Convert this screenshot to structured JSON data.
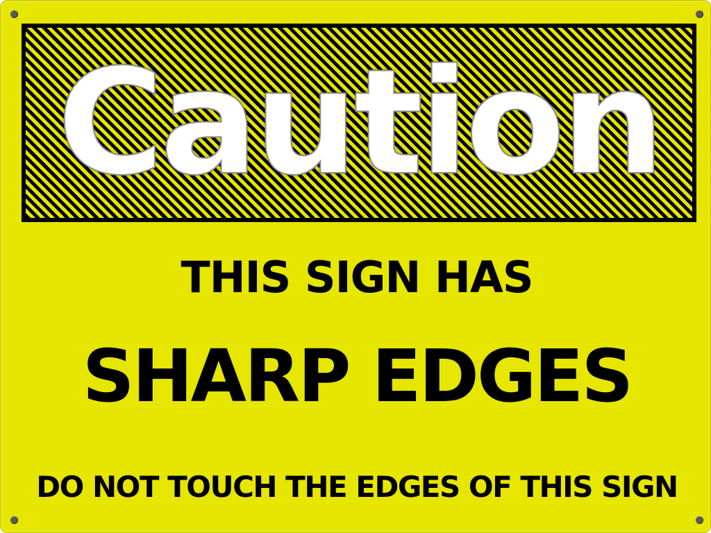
{
  "sign": {
    "header": "Caution",
    "line1": "THIS SIGN HAS",
    "line2": "SHARP EDGES",
    "line3": "DO NOT TOUCH THE EDGES OF THIS SIGN"
  },
  "colors": {
    "background": "#e6e600",
    "stripe_dark": "#000000",
    "header_text": "#ffffff",
    "body_text": "#000000"
  }
}
